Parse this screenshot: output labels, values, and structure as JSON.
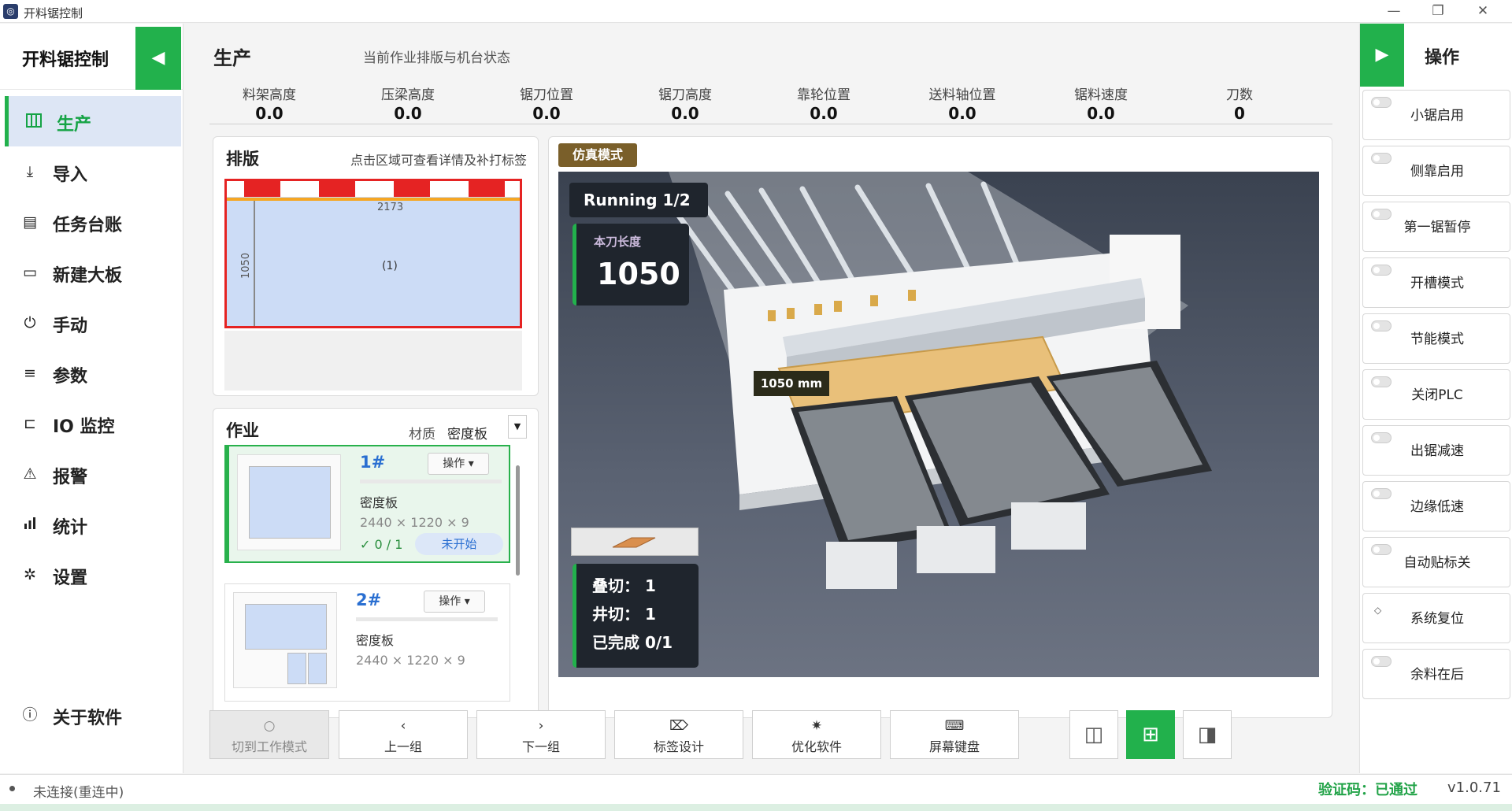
{
  "window": {
    "title": "开料锯控制"
  },
  "sidebar": {
    "brand": "开料锯控制",
    "items": [
      {
        "label": "生产",
        "icon": "grid-icon",
        "active": true
      },
      {
        "label": "导入",
        "icon": "download-icon"
      },
      {
        "label": "任务台账",
        "icon": "ledger-icon"
      },
      {
        "label": "新建大板",
        "icon": "monitor-icon"
      },
      {
        "label": "手动",
        "icon": "power-icon"
      },
      {
        "label": "参数",
        "icon": "lines-icon"
      },
      {
        "label": "IO 监控",
        "icon": "chip-icon"
      },
      {
        "label": "报警",
        "icon": "warning-icon"
      },
      {
        "label": "统计",
        "icon": "bar-chart-icon"
      },
      {
        "label": "设置",
        "icon": "gear-icon"
      }
    ],
    "about": "关于软件"
  },
  "header": {
    "title": "生产",
    "subtitle": "当前作业排版与机台状态"
  },
  "stats": [
    {
      "label": "料架高度",
      "value": "0.0"
    },
    {
      "label": "压梁高度",
      "value": "0.0"
    },
    {
      "label": "锯刀位置",
      "value": "0.0"
    },
    {
      "label": "锯刀高度",
      "value": "0.0"
    },
    {
      "label": "靠轮位置",
      "value": "0.0"
    },
    {
      "label": "送料轴位置",
      "value": "0.0"
    },
    {
      "label": "锯料速度",
      "value": "0.0"
    },
    {
      "label": "刀数",
      "value": "0"
    }
  ],
  "layout_card": {
    "title": "排版",
    "hint": "点击区域可查看详情及补打标签",
    "dim_w": "2173",
    "dim_h": "1050",
    "piece": "(1)"
  },
  "jobs_card": {
    "title": "作业",
    "mat_label": "材质",
    "mat_value": "密度板",
    "jobs": [
      {
        "num": "1#",
        "op": "操作 ▾",
        "material": "密度板",
        "size": "2440 × 1220 × 9",
        "progress": "✓ 0 / 1",
        "status": "未开始"
      },
      {
        "num": "2#",
        "op": "操作 ▾",
        "material": "密度板",
        "size": "2440 × 1220 × 9"
      }
    ]
  },
  "sim": {
    "badge": "仿真模式",
    "running": "Running   1/2",
    "cut_len_label": "本刀长度",
    "cut_len_value": "1050",
    "mm_label": "1050 mm",
    "info": [
      "叠切： 1",
      "井切： 1",
      "已完成 0/1"
    ]
  },
  "toolbar": [
    {
      "label": "切到工作模式",
      "icon": "○",
      "disabled": true
    },
    {
      "label": "上一组",
      "icon": "‹"
    },
    {
      "label": "下一组",
      "icon": "›"
    },
    {
      "label": "标签设计",
      "icon": "⌦"
    },
    {
      "label": "优化软件",
      "icon": "✷"
    },
    {
      "label": "屏幕键盘",
      "icon": "⌨"
    }
  ],
  "ops": {
    "title": "操作",
    "items": [
      "小锯启用",
      "侧靠启用",
      "第一锯暂停",
      "开槽模式",
      "节能模式",
      "关闭PLC",
      "出锯减速",
      "边缘低速",
      "自动贴标关",
      "系统复位",
      "余料在后"
    ]
  },
  "status": {
    "connection": "未连接(重连中)",
    "verify": "验证码：已通过",
    "version": "v1.0.71"
  },
  "colors": {
    "accent": "#22b14c",
    "board_border": "#e52323",
    "board_fill": "#ccdcf6",
    "sim_badge": "#7a5f2a"
  }
}
